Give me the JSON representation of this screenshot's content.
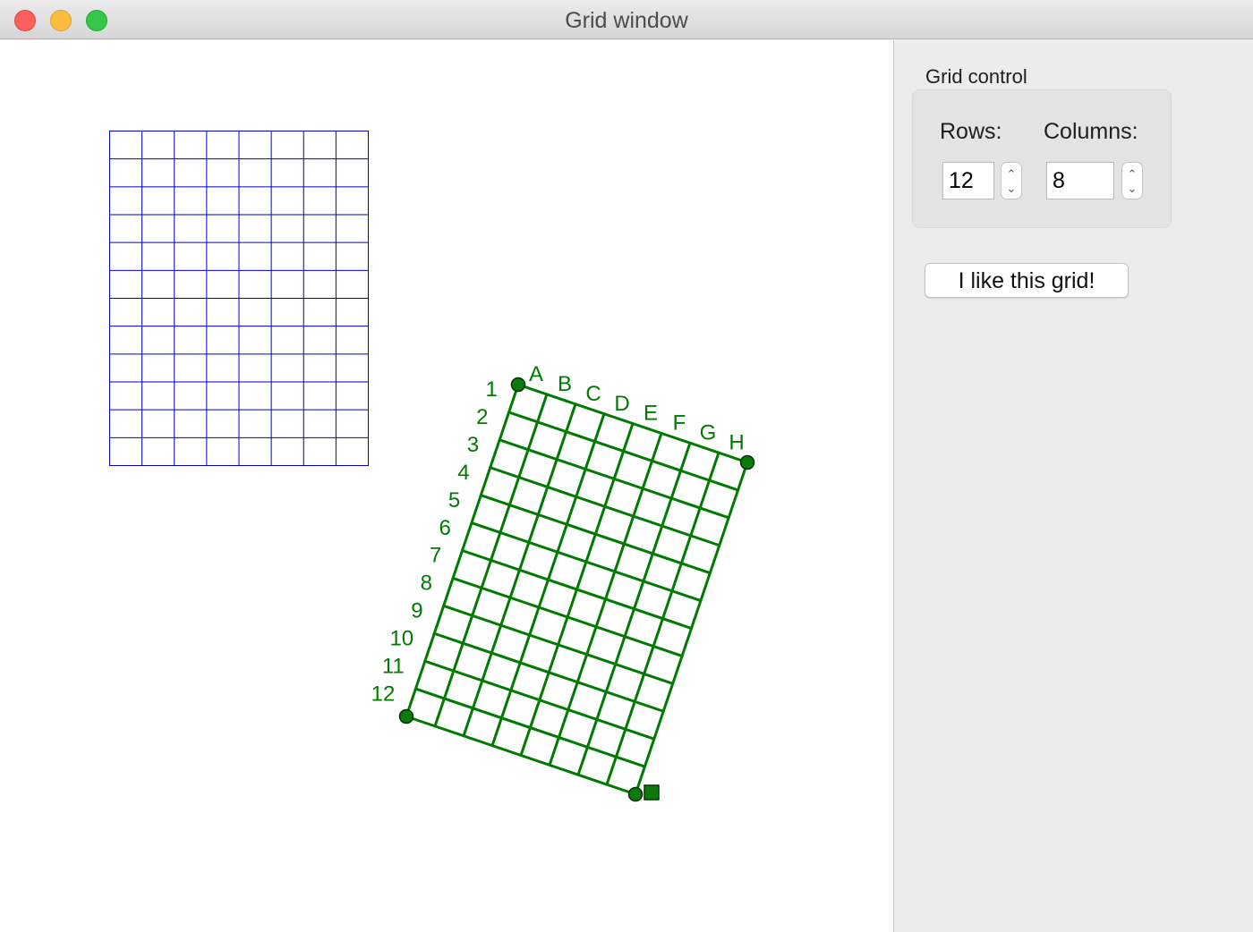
{
  "window": {
    "title": "Grid window"
  },
  "grid_control": {
    "label": "Grid control",
    "rows_label": "Rows:",
    "rows_value": "12",
    "columns_label": "Columns:",
    "columns_value": "8"
  },
  "like_button": {
    "label": "I like this grid!"
  },
  "grid": {
    "rows": 12,
    "columns": 8,
    "column_labels": [
      "A",
      "B",
      "C",
      "D",
      "E",
      "F",
      "G",
      "H"
    ],
    "row_labels": [
      "1",
      "2",
      "3",
      "4",
      "5",
      "6",
      "7",
      "8",
      "9",
      "10",
      "11",
      "12"
    ]
  },
  "colors": {
    "preview_grid": "#0000cc",
    "transformed_grid": "#007a00",
    "handle_fill": "#0a7a0a"
  }
}
